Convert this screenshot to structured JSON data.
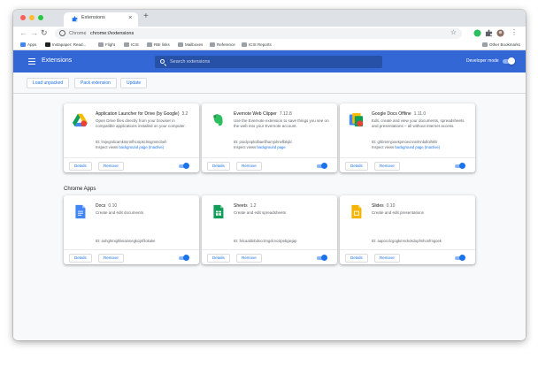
{
  "browser": {
    "tab_title": "Extensions",
    "new_tab_symbol": "+",
    "close_symbol": "×",
    "url_scheme": "Chrome",
    "url_separator": "|",
    "url": "chrome://extensions",
    "back_symbol": "←",
    "forward_symbol": "→",
    "reload_symbol": "↻",
    "star_symbol": "☆",
    "menu_symbol": "⋮",
    "bookmarks": [
      "Apps",
      "Instapaper: Read...",
      "Flight",
      "ICIS",
      "RBI links",
      "Mailboxes",
      "Reference",
      "ICIS Reports"
    ],
    "other_bookmarks": "Other Bookmarks"
  },
  "header": {
    "title": "Extensions",
    "search_placeholder": "Search extensions",
    "developer_mode_label": "Developer mode",
    "developer_mode_on": true
  },
  "toolbar": {
    "load_unpacked": "Load unpacked",
    "pack_extension": "Pack extension",
    "update": "Update"
  },
  "extensions": [
    {
      "name": "Application Launcher for Drive (by Google)",
      "version": "3.2",
      "description": "Open Drive files directly from your browser in compatible applications installed on your computer.",
      "id": "ID: lmjegmlicamkimrmfhcmpkclmigmmcbeh",
      "inspect_label": "Inspect views",
      "inspect_link": "background page (Inactive)",
      "icon": "drive-icon"
    },
    {
      "name": "Evernote Web Clipper",
      "version": "7.12.8",
      "description": "Use the Evernote extension to save things you see on the web into your Evernote account.",
      "id": "ID: pioclpoplcdbaefihamjohnefbikjilc",
      "inspect_label": "Inspect views",
      "inspect_link": "background page",
      "icon": "evernote-icon"
    },
    {
      "name": "Google Docs Offline",
      "version": "1.11.0",
      "description": "Edit, create and view your documents, spreadsheets and presentations – all without internet access.",
      "id": "ID: ghbmnnjooekpmoecnnnilnnbdlolhkhi",
      "inspect_label": "Inspect views",
      "inspect_link": "background page (Inactive)",
      "icon": "docs-offline-icon"
    }
  ],
  "chrome_apps_title": "Chrome Apps",
  "apps": [
    {
      "name": "Docs",
      "version": "0.10",
      "description": "Create and edit documents",
      "id": "ID: aohghmighlieiainnegkcijnfilokake",
      "icon": "docs-icon"
    },
    {
      "name": "Sheets",
      "version": "1.2",
      "description": "Create and edit spreadsheets",
      "id": "ID: felcaaldnbdncclmgdcncolpebgiejap",
      "icon": "sheets-icon"
    },
    {
      "name": "Slides",
      "version": "0.10",
      "description": "Create and edit presentations",
      "id": "ID: aapocclcgogkmnckokdopfmhonfmgoek",
      "icon": "slides-icon"
    }
  ],
  "card_buttons": {
    "details": "Details",
    "remove": "Remove"
  },
  "colors": {
    "header_blue": "#3367d6",
    "accent_blue": "#1a73e8",
    "page_bg": "#f8f9fa"
  }
}
